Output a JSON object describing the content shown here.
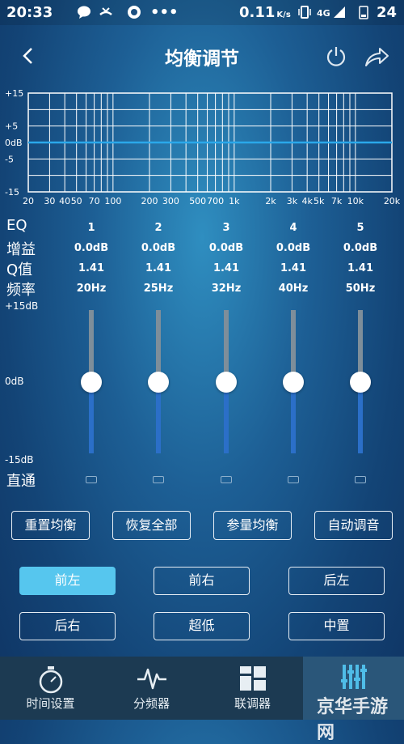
{
  "status": {
    "time": "20:33",
    "speed": "0.11",
    "speed_unit": "K/s",
    "network": "4G",
    "battery": "24"
  },
  "header": {
    "title": "均衡调节"
  },
  "chart_data": {
    "type": "line",
    "title": "",
    "xlabel": "",
    "ylabel": "",
    "x_scale": "log",
    "x_tick_labels": [
      "20",
      "30",
      "40",
      "50",
      "70",
      "100",
      "200",
      "300",
      "500",
      "700",
      "1k",
      "2k",
      "3k",
      "4k",
      "5k",
      "7k",
      "10k",
      "20k"
    ],
    "y_tick_labels": [
      "+15",
      "+5",
      "0dB",
      "-5",
      "-15"
    ],
    "ylim": [
      -15,
      15
    ],
    "series": [
      {
        "x": [
          20,
          20000
        ],
        "y": [
          0,
          0
        ]
      }
    ],
    "grid": true
  },
  "table": {
    "labels": {
      "eq": "EQ",
      "gain": "增益",
      "q": "Q值",
      "freq": "频率"
    },
    "bands": [
      {
        "num": "1",
        "gain": "0.0dB",
        "q": "1.41",
        "freq": "20Hz",
        "level": 0
      },
      {
        "num": "2",
        "gain": "0.0dB",
        "q": "1.41",
        "freq": "25Hz",
        "level": 0
      },
      {
        "num": "3",
        "gain": "0.0dB",
        "q": "1.41",
        "freq": "32Hz",
        "level": 0
      },
      {
        "num": "4",
        "gain": "0.0dB",
        "q": "1.41",
        "freq": "40Hz",
        "level": 0
      },
      {
        "num": "5",
        "gain": "0.0dB",
        "q": "1.41",
        "freq": "50Hz",
        "level": 0
      }
    ]
  },
  "slider_scale": {
    "top": "+15dB",
    "mid": "0dB",
    "bottom": "-15dB"
  },
  "bypass_label": "直通",
  "actions": {
    "reset": "重置均衡",
    "restore": "恢复全部",
    "param": "参量均衡",
    "auto": "自动调音"
  },
  "channels": {
    "fl": "前左",
    "fr": "前右",
    "rl": "后左",
    "rr": "后右",
    "sub": "超低",
    "center": "中置"
  },
  "nav": {
    "time": "时间设置",
    "crossover": "分频器",
    "tuner": "联调器"
  },
  "watermark": "京华手游网",
  "colors": {
    "accent": "#56c6ee",
    "flat_line": "#2aa8ea",
    "slider_fill": "#2b6fc8"
  }
}
